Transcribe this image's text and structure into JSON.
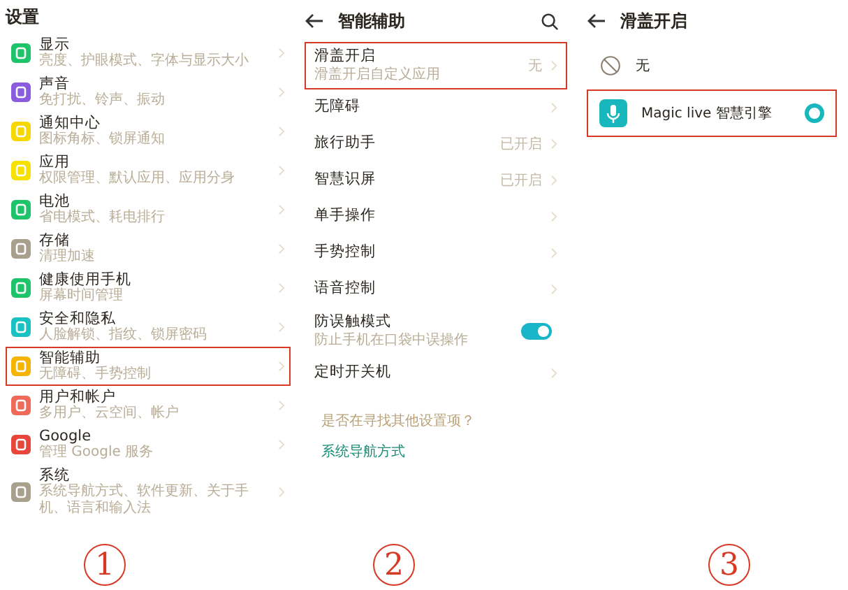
{
  "settings": {
    "title": "设置",
    "marker": "1",
    "items": [
      {
        "name": "显示",
        "detail": "亮度、护眼模式、字体与显示大小",
        "color": "#1fc46a",
        "highlighted": false
      },
      {
        "name": "声音",
        "detail": "免打扰、铃声、振动",
        "color": "#8a5ce0",
        "highlighted": false
      },
      {
        "name": "通知中心",
        "detail": "图标角标、锁屏通知",
        "color": "#f5d800",
        "highlighted": false
      },
      {
        "name": "应用",
        "detail": "权限管理、默认应用、应用分身",
        "color": "#f5e000",
        "highlighted": false
      },
      {
        "name": "电池",
        "detail": "省电模式、耗电排行",
        "color": "#1fc46a",
        "highlighted": false
      },
      {
        "name": "存储",
        "detail": "清理加速",
        "color": "#a89f8c",
        "highlighted": false
      },
      {
        "name": "健康使用手机",
        "detail": "屏幕时间管理",
        "color": "#1fc46a",
        "highlighted": false
      },
      {
        "name": "安全和隐私",
        "detail": "人脸解锁、指纹、锁屏密码",
        "color": "#19c2c2",
        "highlighted": false
      },
      {
        "name": "智能辅助",
        "detail": "无障碍、手势控制",
        "color": "#f5b400",
        "highlighted": true
      },
      {
        "name": "用户和帐户",
        "detail": "多用户、云空间、帐户",
        "color": "#f06a5a",
        "highlighted": false
      },
      {
        "name": "Google",
        "detail": "管理 Google 服务",
        "color": "#e8453c",
        "highlighted": false
      },
      {
        "name": "系统",
        "detail": "系统导航方式、软件更新、关于手机、语言和输入法",
        "color": "#a89f8c",
        "highlighted": false
      }
    ]
  },
  "assist": {
    "title": "智能辅助",
    "marker": "2",
    "items": [
      {
        "kind": "nav",
        "name": "滑盖开启",
        "detail": "滑盖开启自定义应用",
        "value": "无",
        "highlighted": true
      },
      {
        "kind": "nav",
        "name": "无障碍",
        "highlighted": false
      },
      {
        "kind": "nav",
        "name": "旅行助手",
        "value": "已开启",
        "highlighted": false
      },
      {
        "kind": "nav",
        "name": "智慧识屏",
        "value": "已开启",
        "highlighted": false
      },
      {
        "kind": "nav",
        "name": "单手操作",
        "highlighted": false
      },
      {
        "kind": "nav",
        "name": "手势控制",
        "highlighted": false
      },
      {
        "kind": "nav",
        "name": "语音控制",
        "highlighted": false
      },
      {
        "kind": "toggle",
        "name": "防误触模式",
        "detail": "防止手机在口袋中误操作",
        "on": true,
        "highlighted": false
      },
      {
        "kind": "nav",
        "name": "定时开关机",
        "highlighted": false
      }
    ],
    "question": "是否在寻找其他设置项？",
    "link": "系统导航方式"
  },
  "slide": {
    "title": "滑盖开启",
    "marker": "3",
    "options": [
      {
        "kind": "none",
        "label": "无",
        "selected": false,
        "highlighted": false
      },
      {
        "kind": "app",
        "label": "Magic live 智慧引擎",
        "selected": true,
        "highlighted": true
      }
    ]
  }
}
